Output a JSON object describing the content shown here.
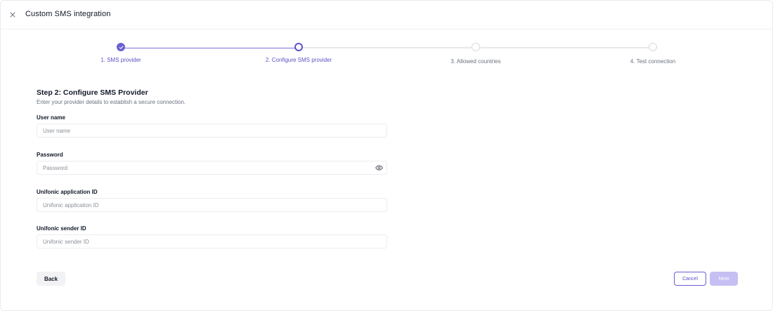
{
  "header": {
    "title": "Custom SMS integration",
    "close_icon": "close-icon"
  },
  "stepper": {
    "steps": [
      {
        "label": "1. SMS provider",
        "state": "complete"
      },
      {
        "label": "2. Configure SMS provider",
        "state": "current"
      },
      {
        "label": "3. Allowed countries",
        "state": "upcoming"
      },
      {
        "label": "4. Test connection",
        "state": "upcoming"
      }
    ],
    "colors": {
      "complete": "#6b5fd3",
      "current": "#5e52c9",
      "upcoming": "#d8d8de"
    }
  },
  "form": {
    "heading": "Step 2: Configure SMS Provider",
    "subheading": "Enter your provider details to establish a secure connection.",
    "fields": {
      "username": {
        "label": "User name",
        "placeholder": "User name",
        "value": ""
      },
      "password": {
        "label": "Password",
        "placeholder": "Password",
        "value": "",
        "icon": "eye-icon"
      },
      "app_id": {
        "label": "Unifonic application ID",
        "placeholder": "Unifonic application ID",
        "value": ""
      },
      "sender_id": {
        "label": "Unifonic sender ID",
        "placeholder": "Unifonic sender ID",
        "value": ""
      }
    }
  },
  "footer": {
    "back_label": "Back",
    "cancel_label": "Cancel",
    "next_label": "Next",
    "next_disabled": true,
    "accent": "#6b5fd3"
  }
}
